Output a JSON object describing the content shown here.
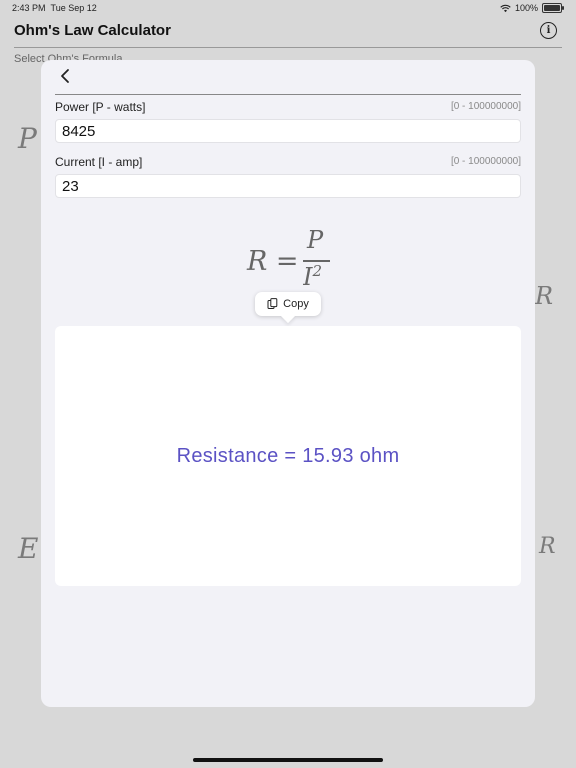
{
  "status_bar": {
    "time": "2:43 PM",
    "date": "Tue Sep 12",
    "battery": "100%",
    "battery_level": 1.0
  },
  "app": {
    "title": "Ohm's Law Calculator",
    "background_label": "Select Ohm's Formula"
  },
  "background_glyphs": [
    "P",
    "E",
    "R",
    "R"
  ],
  "fields": [
    {
      "label": "Power [P - watts]",
      "range": "[0 - 100000000]",
      "value": "8425"
    },
    {
      "label": "Current [I - amp]",
      "range": "[0 - 100000000]",
      "value": "23"
    }
  ],
  "formula": {
    "lhs": "R =",
    "numerator": "P",
    "denominator": "I",
    "exponent": "2"
  },
  "copy_menu": {
    "label": "Copy"
  },
  "result": {
    "text": "Resistance = 15.93 ohm",
    "color": "#5b52c4"
  },
  "icons": {
    "wifi": "wifi-icon",
    "info": "info-icon",
    "back": "chevron-left-icon",
    "copy": "copy-icon"
  }
}
